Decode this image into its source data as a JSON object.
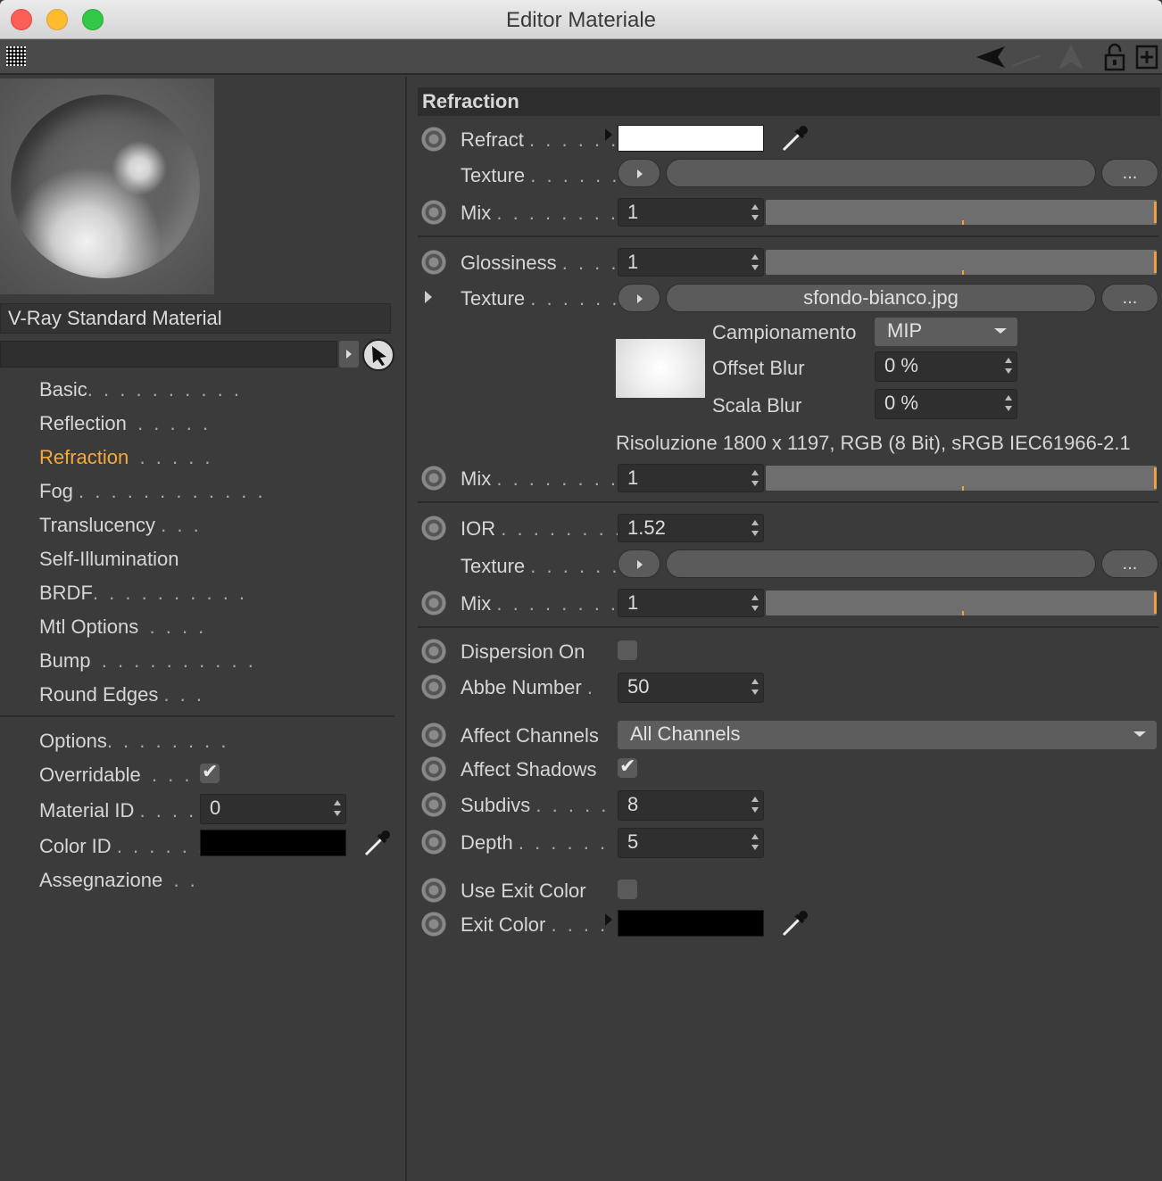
{
  "window": {
    "title": "Editor Materiale"
  },
  "left": {
    "material_name": "V-Ray Standard Material",
    "nav": [
      {
        "label": "Basic",
        "dots": ". . . . . . . . . ."
      },
      {
        "label": "Reflection",
        "dots": ". . . . ."
      },
      {
        "label": "Refraction",
        "dots": ". . . . ."
      },
      {
        "label": "Fog",
        "dots": ". . . . . . . . . . . ."
      },
      {
        "label": "Translucency",
        "dots": ". . ."
      },
      {
        "label": "Self-Illumination",
        "dots": ""
      },
      {
        "label": "BRDF",
        "dots": ". . . . . . . . . ."
      },
      {
        "label": "Mtl Options",
        "dots": ". . . ."
      },
      {
        "label": "Bump",
        "dots": ". . . . . . . . . ."
      },
      {
        "label": "Round Edges",
        "dots": ". . ."
      }
    ],
    "options": {
      "label": "Options",
      "dots": ". . . . . . . ."
    },
    "overridable": {
      "label": "Overridable",
      "dots": ". . . .",
      "checked": true
    },
    "material_id": {
      "label": "Material ID",
      "dots": ". . . . .",
      "value": "0"
    },
    "color_id": {
      "label": "Color ID",
      "dots": ". . . . . . .",
      "color": "#000000"
    },
    "assegnazione": {
      "label": "Assegnazione",
      "dots": ". ."
    }
  },
  "right": {
    "section_title": "Refraction",
    "refract": {
      "label": "Refract",
      "dots": ". . . . . .",
      "color": "#ffffff"
    },
    "texture1": {
      "label": "Texture",
      "dots": ". . . . . . .",
      "more": "..."
    },
    "mix1": {
      "label": "Mix",
      "dots": ". . . . . . . . . .",
      "value": "1",
      "level": 1
    },
    "glossiness": {
      "label": "Glossiness",
      "dots": ". . . .",
      "value": "1",
      "level": 1
    },
    "texture2": {
      "label": "Texture",
      "dots": ". . . . . . .",
      "file": "sfondo-bianco.jpg",
      "more": "..."
    },
    "campionamento": {
      "label": "Campionamento",
      "value": "MIP"
    },
    "offset_blur": {
      "label": "Offset Blur",
      "value": "0 %"
    },
    "scala_blur": {
      "label": "Scala Blur",
      "value": "0 %"
    },
    "risoluzione": "Risoluzione 1800 x 1197, RGB (8 Bit), sRGB IEC61966-2.1",
    "mix2": {
      "label": "Mix",
      "dots": ". . . . . . . . . .",
      "value": "1",
      "level": 1
    },
    "ior": {
      "label": "IOR",
      "dots": ". . . . . . . . . .",
      "value": "1.52"
    },
    "texture3": {
      "label": "Texture",
      "dots": ". . . . . . .",
      "more": "..."
    },
    "mix3": {
      "label": "Mix",
      "dots": ". . . . . . . . . .",
      "value": "1",
      "level": 1
    },
    "dispersion": {
      "label": "Dispersion On",
      "checked": false
    },
    "abbe": {
      "label": "Abbe Number",
      "dots": ".",
      "value": "50"
    },
    "affect_channels": {
      "label": "Affect Channels",
      "value": "All Channels"
    },
    "affect_shadows": {
      "label": "Affect Shadows",
      "checked": true
    },
    "subdivs": {
      "label": "Subdivs",
      "dots": ". . . . . .",
      "value": "8"
    },
    "depth": {
      "label": "Depth",
      "dots": ". . . . . . . .",
      "value": "5"
    },
    "use_exit_color": {
      "label": "Use Exit Color",
      "checked": false
    },
    "exit_color": {
      "label": "Exit Color",
      "dots": ". . . .",
      "color": "#000000"
    }
  },
  "icons": [
    "grid-icon",
    "back-arrow-icon",
    "forward-arrow-icon",
    "up-arrow-icon",
    "lock-icon",
    "new-window-icon",
    "cursor-icon",
    "eyedropper-icon",
    "checkmark-icon"
  ]
}
